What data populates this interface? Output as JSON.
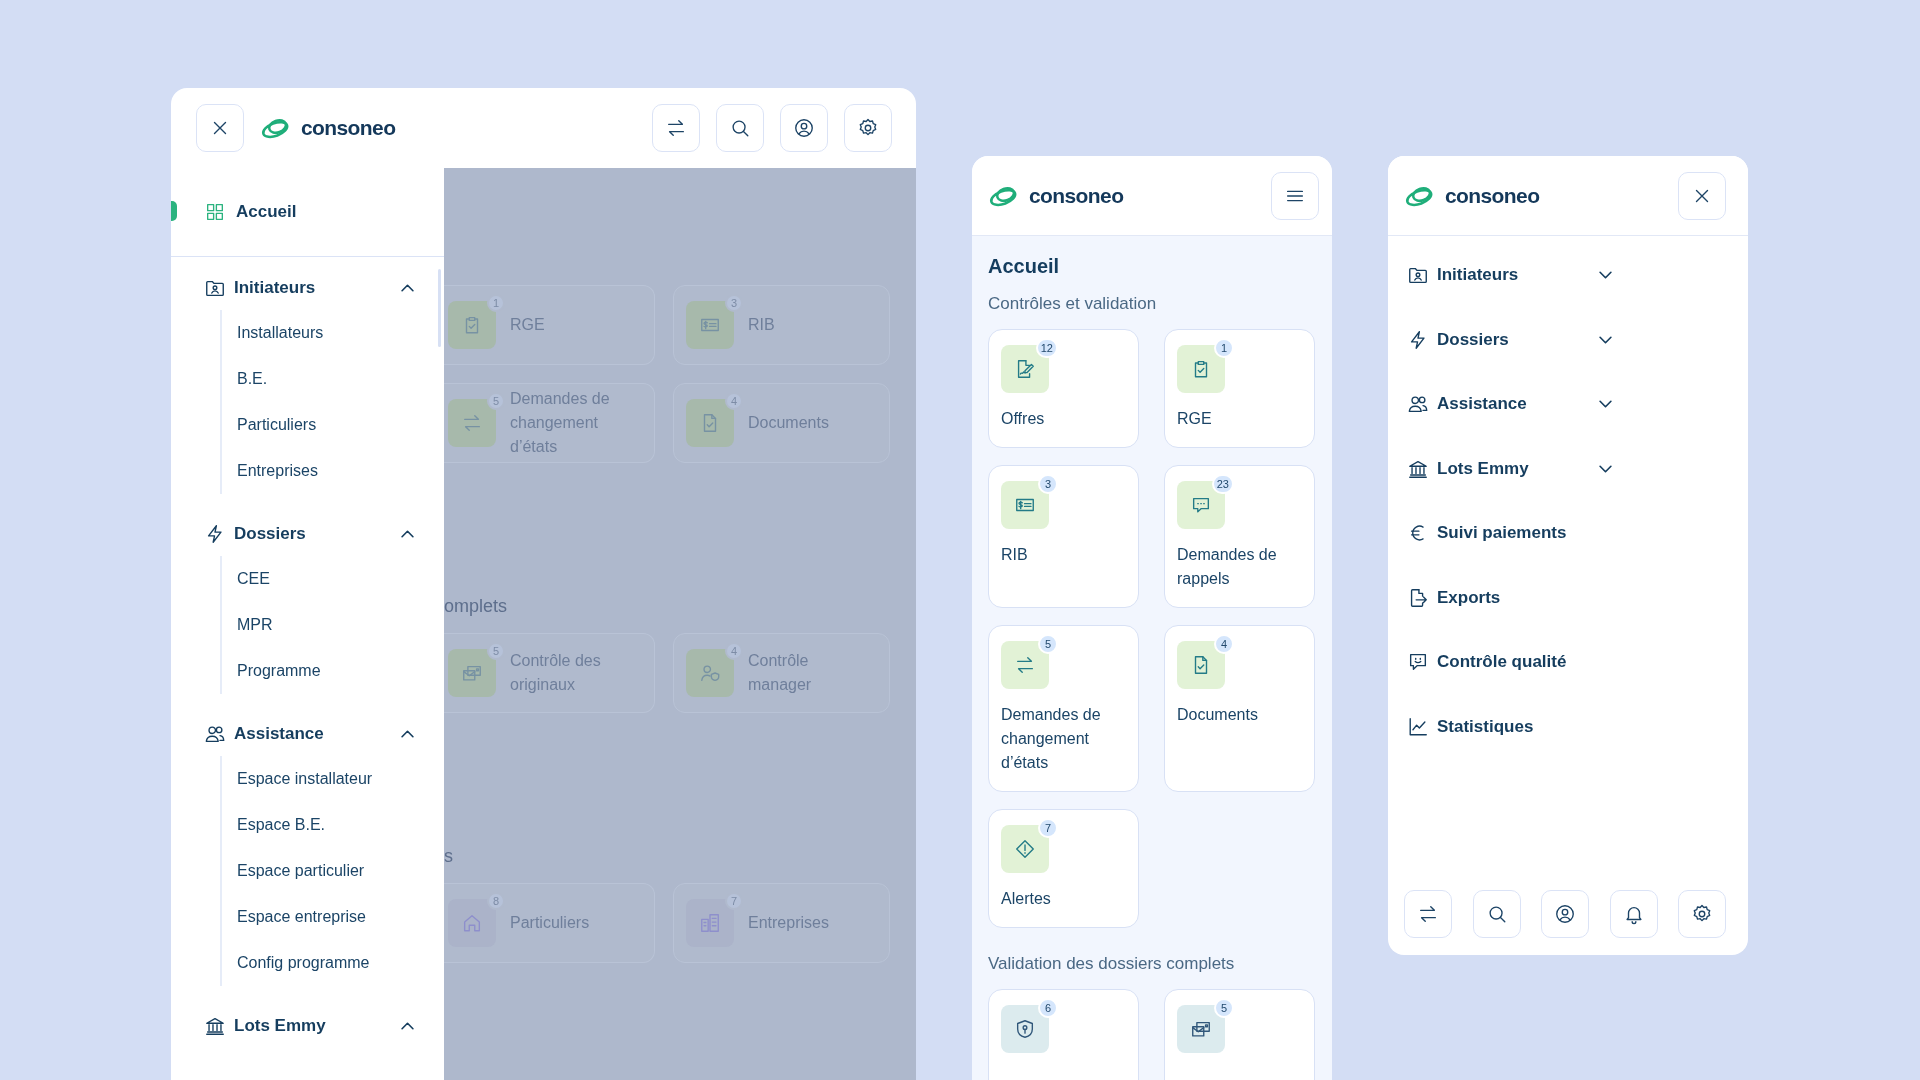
{
  "desktop_menu": {
    "logo": "consoneo",
    "home": {
      "label": "Accueil",
      "selected": true
    },
    "groups": [
      {
        "label": "Initiateurs",
        "expanded": true,
        "children": [
          {
            "label": "Installateurs"
          },
          {
            "label": "B.E."
          },
          {
            "label": "Particuliers"
          },
          {
            "label": "Entreprises"
          }
        ]
      },
      {
        "label": "Dossiers",
        "expanded": true,
        "children": [
          {
            "label": "CEE"
          },
          {
            "label": "MPR"
          },
          {
            "label": "Programme"
          }
        ]
      },
      {
        "label": "Assistance",
        "expanded": true,
        "children": [
          {
            "label": "Espace installateur"
          },
          {
            "label": "Espace B.E."
          },
          {
            "label": "Espace particulier"
          },
          {
            "label": "Espace entreprise"
          },
          {
            "label": "Config programme"
          }
        ]
      },
      {
        "label": "Lots Emmy",
        "expanded": true
      }
    ],
    "background_page": {
      "sections": [
        {
          "cards": [
            {
              "label": "RGE",
              "count": "1"
            },
            {
              "label": "RIB",
              "count": "3"
            },
            {
              "label": "Demandes de changement d’états",
              "count": "5"
            },
            {
              "label": "Documents",
              "count": "4"
            }
          ]
        },
        {
          "title": "omplets",
          "cards": [
            {
              "label": "Contrôle des originaux",
              "count": "5"
            },
            {
              "label": "Contrôle manager",
              "count": "4"
            }
          ]
        },
        {
          "title": "s",
          "cards": [
            {
              "label": "Particuliers",
              "count": "8"
            },
            {
              "label": "Entreprises",
              "count": "7"
            }
          ]
        }
      ]
    }
  },
  "mobile_home": {
    "logo": "consoneo",
    "title": "Accueil",
    "sections": [
      {
        "title": "Contrôles et validation",
        "cards": [
          {
            "label": "Offres",
            "count": "12"
          },
          {
            "label": "RGE",
            "count": "1"
          },
          {
            "label": "RIB",
            "count": "3"
          },
          {
            "label": "Demandes de rappels",
            "count": "23"
          },
          {
            "label": "Demandes de changement d’états",
            "count": "5"
          },
          {
            "label": "Documents",
            "count": "4"
          },
          {
            "label": "Alertes",
            "count": "7"
          }
        ]
      },
      {
        "title": "Validation des dossiers complets",
        "cards": [
          {
            "count": "6"
          },
          {
            "count": "5"
          }
        ]
      }
    ]
  },
  "mobile_menu": {
    "logo": "consoneo",
    "items": [
      {
        "label": "Initiateurs",
        "kind": "group",
        "expanded": false
      },
      {
        "label": "Dossiers",
        "kind": "group",
        "expanded": false
      },
      {
        "label": "Assistance",
        "kind": "group",
        "expanded": false
      },
      {
        "label": "Lots Emmy",
        "kind": "group",
        "expanded": false
      },
      {
        "label": "Suivi paiements",
        "kind": "link"
      },
      {
        "label": "Exports",
        "kind": "link"
      },
      {
        "label": "Contrôle qualité",
        "kind": "link"
      },
      {
        "label": "Statistiques",
        "kind": "link"
      }
    ]
  }
}
